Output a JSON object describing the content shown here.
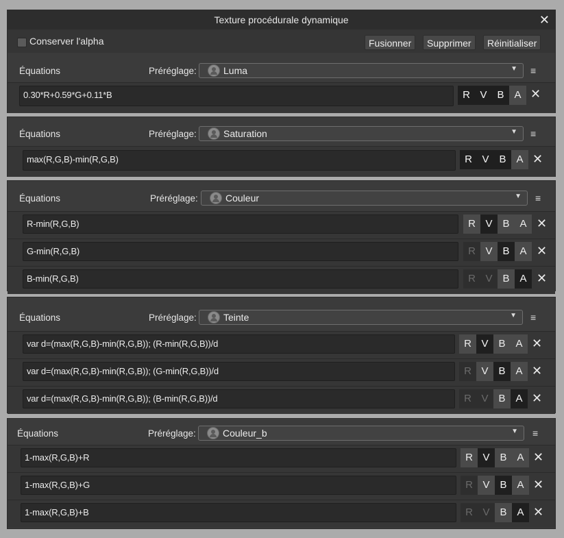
{
  "window": {
    "title": "Texture procédurale dynamique",
    "close_icon": "close-icon"
  },
  "toolbar": {
    "checkbox_label": "Conserver l'alpha",
    "checkbox_checked": false,
    "merge": "Fusionner",
    "delete": "Supprimer",
    "reset": "Réinitialiser"
  },
  "labels": {
    "equations": "Équations",
    "preset": "Préréglage:"
  },
  "channel_labels": [
    "R",
    "V",
    "B",
    "A"
  ],
  "panels": [
    {
      "preset": "Luma",
      "rows": [
        {
          "eq": "0.30*R+0.59*G+0.11*B",
          "active": [
            true,
            true,
            true,
            true
          ],
          "highlight": 3
        }
      ]
    },
    {
      "preset": "Saturation",
      "rows": [
        {
          "eq": "max(R,G,B)-min(R,G,B)",
          "active": [
            true,
            true,
            true,
            true
          ],
          "highlight": 3
        }
      ]
    },
    {
      "preset": "Couleur",
      "rows": [
        {
          "eq": "R-min(R,G,B)",
          "active": [
            true,
            true,
            true,
            true
          ],
          "highlight": 1
        },
        {
          "eq": "G-min(R,G,B)",
          "active": [
            false,
            true,
            true,
            true
          ],
          "highlight": 2
        },
        {
          "eq": "B-min(R,G,B)",
          "active": [
            false,
            false,
            true,
            true
          ],
          "highlight": 3
        }
      ]
    },
    {
      "preset": "Teinte",
      "rows": [
        {
          "eq": "var d=(max(R,G,B)-min(R,G,B)); (R-min(R,G,B))/d",
          "active": [
            true,
            true,
            true,
            true
          ],
          "highlight": 1
        },
        {
          "eq": "var d=(max(R,G,B)-min(R,G,B)); (G-min(R,G,B))/d",
          "active": [
            false,
            true,
            true,
            true
          ],
          "highlight": 2
        },
        {
          "eq": "var d=(max(R,G,B)-min(R,G,B)); (B-min(R,G,B))/d",
          "active": [
            false,
            false,
            true,
            true
          ],
          "highlight": 3
        }
      ]
    },
    {
      "preset": "Couleur_b",
      "rows": [
        {
          "eq": "1-max(R,G,B)+R",
          "active": [
            true,
            true,
            true,
            true
          ],
          "highlight": 1
        },
        {
          "eq": "1-max(R,G,B)+G",
          "active": [
            false,
            true,
            true,
            true
          ],
          "highlight": 2
        },
        {
          "eq": "1-max(R,G,B)+B",
          "active": [
            false,
            false,
            true,
            true
          ],
          "highlight": 3
        }
      ]
    }
  ]
}
